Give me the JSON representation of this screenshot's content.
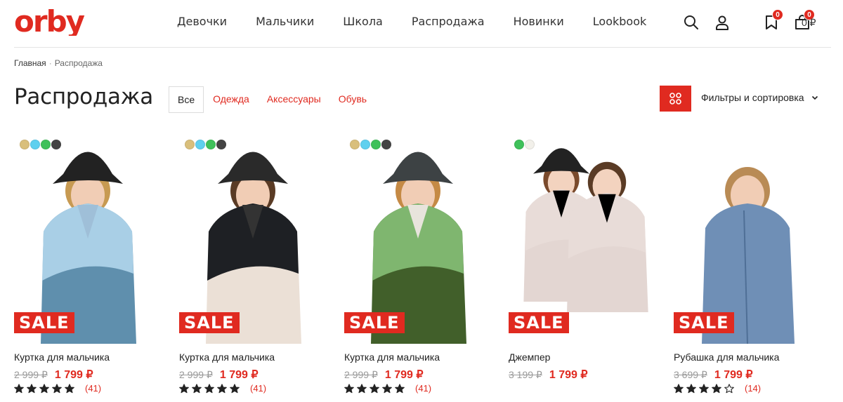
{
  "brand": {
    "logo_text": "orby",
    "accent_color": "#e02a20"
  },
  "nav": [
    "Девочки",
    "Мальчики",
    "Школа",
    "Распродажа",
    "Новинки",
    "Lookbook"
  ],
  "header": {
    "search_icon": "search-icon",
    "account_icon": "user-icon",
    "favorites_count": "0",
    "cart_count": "0",
    "cart_total": "0 ₽"
  },
  "breadcrumb": {
    "home": "Главная",
    "separator": "·",
    "current": "Распродажа"
  },
  "page": {
    "title": "Распродажа",
    "tabs": [
      "Все",
      "Одежда",
      "Аксессуары",
      "Обувь"
    ],
    "active_tab": "Все",
    "filters_label": "Фильтры и сортировка"
  },
  "sale_label": "SALE",
  "products": [
    {
      "name": "Куртка для мальчика",
      "old_price": "2 999 ₽",
      "price": "1 799 ₽",
      "rating": 5,
      "reviews": "(41)",
      "swatches": [
        "#d9bf7c",
        "#5fd0ef",
        "#3fc15a",
        "#444444"
      ]
    },
    {
      "name": "Куртка для мальчика",
      "old_price": "2 999 ₽",
      "price": "1 799 ₽",
      "rating": 5,
      "reviews": "(41)",
      "swatches": [
        "#d9bf7c",
        "#5fd0ef",
        "#3fc15a",
        "#444444"
      ]
    },
    {
      "name": "Куртка для мальчика",
      "old_price": "2 999 ₽",
      "price": "1 799 ₽",
      "rating": 5,
      "reviews": "(41)",
      "swatches": [
        "#d9bf7c",
        "#5fd0ef",
        "#3fc15a",
        "#444444"
      ]
    },
    {
      "name": "Джемпер",
      "old_price": "3 199 ₽",
      "price": "1 799 ₽",
      "rating": 0,
      "reviews": "",
      "swatches": [
        "#3fc15a",
        "#f2f0ea"
      ]
    },
    {
      "name": "Рубашка для мальчика",
      "old_price": "3 699 ₽",
      "price": "1 799 ₽",
      "rating": 4,
      "reviews": "(14)",
      "swatches": []
    }
  ]
}
